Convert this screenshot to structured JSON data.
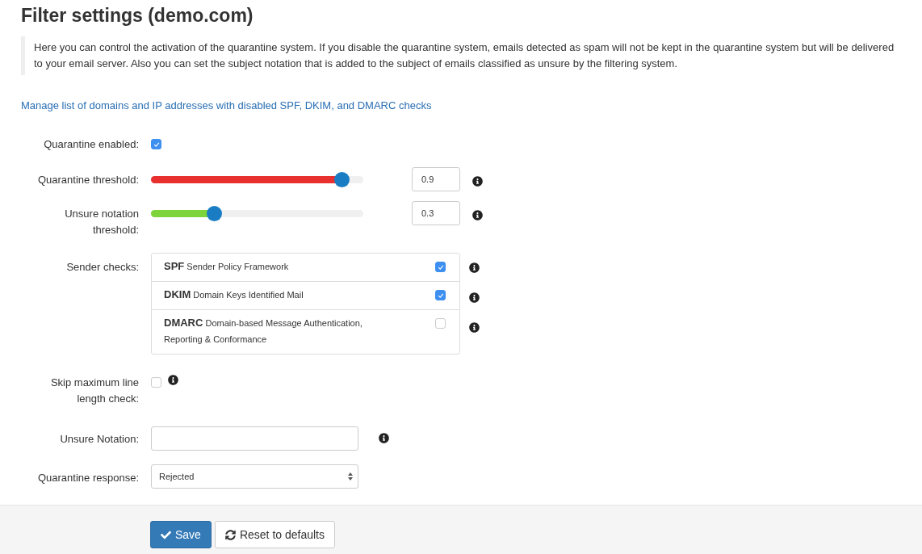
{
  "title": "Filter settings (demo.com)",
  "intro": "Here you can control the activation of the quarantine system. If you disable the quarantine system, emails detected as spam will not be kept in the quarantine system but will be delivered to your email server. Also you can set the subject notation that is added to the subject of emails classified as unsure by the filtering system.",
  "link": "Manage list of domains and IP addresses with disabled SPF, DKIM, and DMARC checks",
  "fields": [
    {
      "kind": "checkbox",
      "label": "Quarantine enabled:",
      "checked": true,
      "info": false
    },
    {
      "kind": "slider",
      "label": "Quarantine threshold:",
      "level": 0.9,
      "color": "#e8312f",
      "value": "0.9",
      "info": true
    },
    {
      "kind": "slider",
      "label": "Unsure notation threshold:",
      "level": 0.3,
      "color": "#7ed43b",
      "value": "0.3",
      "info": true
    },
    {
      "kind": "checklist",
      "label": "Sender checks:",
      "items": [
        {
          "code": "SPF",
          "name": "Sender Policy Framework",
          "checked": true
        },
        {
          "code": "DKIM",
          "name": "Domain Keys Identified Mail",
          "checked": true
        },
        {
          "code": "DMARC",
          "name": "Domain-based Message Authentication, Reporting & Conformance",
          "checked": false
        }
      ]
    },
    {
      "kind": "checkbox",
      "label": "Skip maximum line length check:",
      "checked": false,
      "info": true
    },
    {
      "kind": "text",
      "label": "Unsure Notation:",
      "info": true
    },
    {
      "kind": "select",
      "label": "Quarantine response:",
      "value": "Rejected"
    }
  ],
  "buttons": [
    {
      "kind": "primary",
      "label": "Save"
    },
    {
      "kind": "reset",
      "label": "Reset to defaults"
    }
  ]
}
